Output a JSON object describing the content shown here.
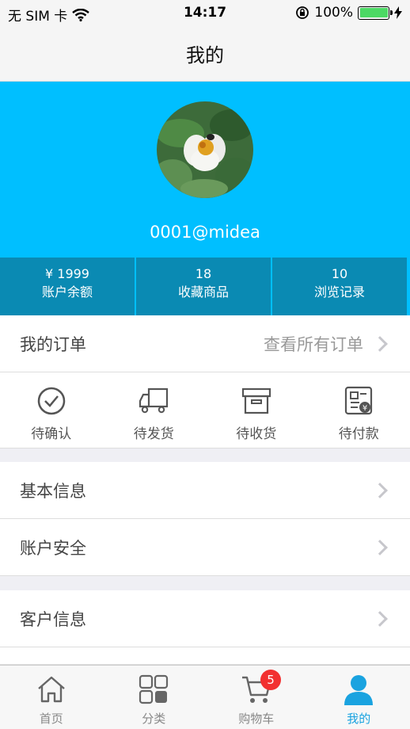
{
  "status": {
    "carrier": "无 SIM 卡",
    "time": "14:17",
    "battery": "100%"
  },
  "nav": {
    "title": "我的"
  },
  "profile": {
    "username": "0001@midea"
  },
  "stats": [
    {
      "value": "¥ 1999",
      "label": "账户余额"
    },
    {
      "value": "18",
      "label": "收藏商品"
    },
    {
      "value": "10",
      "label": "浏览记录"
    }
  ],
  "orders": {
    "title": "我的订单",
    "view_all": "查看所有订单",
    "items": [
      {
        "label": "待确认",
        "icon": "check-circle-icon"
      },
      {
        "label": "待发货",
        "icon": "truck-icon"
      },
      {
        "label": "待收货",
        "icon": "box-icon"
      },
      {
        "label": "待付款",
        "icon": "invoice-icon"
      }
    ]
  },
  "menu": {
    "basic_info": "基本信息",
    "account_security": "账户安全",
    "customer_info": "客户信息"
  },
  "tabbar": {
    "items": [
      {
        "label": "首页",
        "icon": "home-icon"
      },
      {
        "label": "分类",
        "icon": "grid-icon"
      },
      {
        "label": "购物车",
        "icon": "cart-icon",
        "badge": "5"
      },
      {
        "label": "我的",
        "icon": "user-icon"
      }
    ],
    "active_color": "#1aa3e0"
  },
  "colors": {
    "accent": "#00bfff",
    "stats_bg": "#0a8ab3"
  }
}
